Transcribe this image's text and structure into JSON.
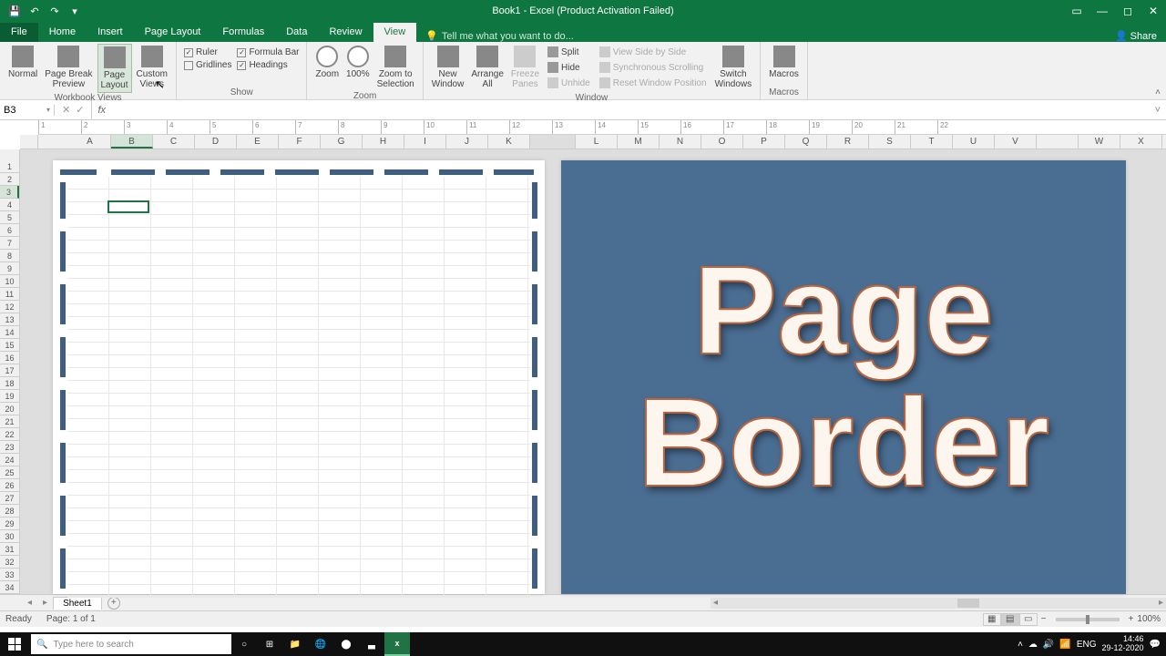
{
  "title": "Book1 - Excel (Product Activation Failed)",
  "tabs": [
    "File",
    "Home",
    "Insert",
    "Page Layout",
    "Formulas",
    "Data",
    "Review",
    "View"
  ],
  "tell_me": "Tell me what you want to do...",
  "share": "Share",
  "ribbon": {
    "workbook_views": {
      "label": "Workbook Views",
      "normal": "Normal",
      "pbreak": "Page Break\nPreview",
      "playout": "Page\nLayout",
      "cviews": "Custom\nViews"
    },
    "show": {
      "label": "Show",
      "ruler": "Ruler",
      "gridlines": "Gridlines",
      "formula_bar": "Formula Bar",
      "headings": "Headings"
    },
    "zoom": {
      "label": "Zoom",
      "zoom": "Zoom",
      "p100": "100%",
      "zsel": "Zoom to\nSelection"
    },
    "window": {
      "label": "Window",
      "nwin": "New\nWindow",
      "aall": "Arrange\nAll",
      "fpanes": "Freeze\nPanes",
      "split": "Split",
      "hide": "Hide",
      "unhide": "Unhide",
      "vsbs": "View Side by Side",
      "sscroll": "Synchronous Scrolling",
      "rwin": "Reset Window Position",
      "switch": "Switch\nWindows"
    },
    "macros": {
      "label": "Macros",
      "macros": "Macros"
    }
  },
  "namebox": "B3",
  "columns_left": [
    "A",
    "B",
    "C",
    "D",
    "E",
    "F",
    "G",
    "H",
    "I",
    "J",
    "K"
  ],
  "columns_right": [
    "L",
    "M",
    "N",
    "O",
    "P",
    "Q",
    "R",
    "S",
    "T",
    "U",
    "V",
    "",
    "W",
    "X"
  ],
  "rows": [
    1,
    2,
    3,
    4,
    5,
    6,
    7,
    8,
    9,
    10,
    11,
    12,
    13,
    14,
    15,
    16,
    17,
    18,
    19,
    20,
    21,
    22,
    23,
    24,
    25,
    26,
    27,
    28,
    29,
    30,
    31,
    32,
    33,
    34
  ],
  "page2_text": [
    "Page",
    "Border"
  ],
  "sheet_tab": "Sheet1",
  "status": {
    "ready": "Ready",
    "page": "Page: 1 of 1",
    "zoom": "100%"
  },
  "taskbar": {
    "search": "Type here to search",
    "lang": "ENG",
    "time": "14:46",
    "date": "29-12-2020"
  }
}
